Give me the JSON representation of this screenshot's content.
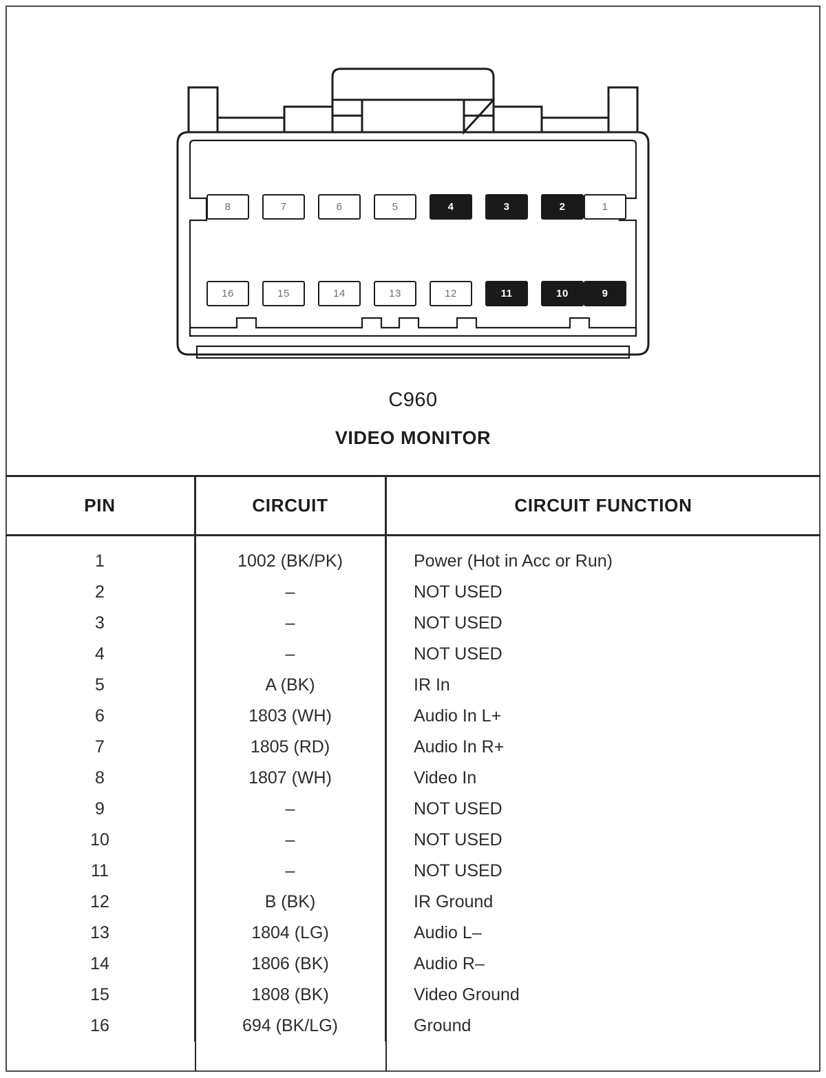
{
  "figure": {
    "connector_id": "C960",
    "connector_name": "VIDEO MONITOR",
    "pin_rows": {
      "top": [
        {
          "number": "8",
          "filled": false
        },
        {
          "number": "7",
          "filled": false
        },
        {
          "number": "6",
          "filled": false
        },
        {
          "number": "5",
          "filled": false
        },
        {
          "number": "4",
          "filled": true
        },
        {
          "number": "3",
          "filled": true
        },
        {
          "number": "2",
          "filled": true
        },
        {
          "number": "1",
          "filled": false
        }
      ],
      "bottom": [
        {
          "number": "16",
          "filled": false
        },
        {
          "number": "15",
          "filled": false
        },
        {
          "number": "14",
          "filled": false
        },
        {
          "number": "13",
          "filled": false
        },
        {
          "number": "12",
          "filled": false
        },
        {
          "number": "11",
          "filled": true
        },
        {
          "number": "10",
          "filled": true
        },
        {
          "number": "9",
          "filled": true
        }
      ]
    }
  },
  "table": {
    "headers": {
      "pin": "PIN",
      "circuit": "CIRCUIT",
      "function": "CIRCUIT FUNCTION"
    },
    "rows": [
      {
        "pin": "1",
        "circuit": "1002 (BK/PK)",
        "function": "Power (Hot in Acc or Run)"
      },
      {
        "pin": "2",
        "circuit": "–",
        "function": "NOT USED"
      },
      {
        "pin": "3",
        "circuit": "–",
        "function": "NOT USED"
      },
      {
        "pin": "4",
        "circuit": "–",
        "function": "NOT USED"
      },
      {
        "pin": "5",
        "circuit": "A (BK)",
        "function": "IR In"
      },
      {
        "pin": "6",
        "circuit": "1803 (WH)",
        "function": "Audio In L+"
      },
      {
        "pin": "7",
        "circuit": "1805 (RD)",
        "function": "Audio In R+"
      },
      {
        "pin": "8",
        "circuit": "1807 (WH)",
        "function": "Video In"
      },
      {
        "pin": "9",
        "circuit": "–",
        "function": "NOT USED"
      },
      {
        "pin": "10",
        "circuit": "–",
        "function": "NOT USED"
      },
      {
        "pin": "11",
        "circuit": "–",
        "function": "NOT USED"
      },
      {
        "pin": "12",
        "circuit": "B (BK)",
        "function": "IR Ground"
      },
      {
        "pin": "13",
        "circuit": "1804 (LG)",
        "function": "Audio L–"
      },
      {
        "pin": "14",
        "circuit": "1806 (BK)",
        "function": "Audio R–"
      },
      {
        "pin": "15",
        "circuit": "1808 (BK)",
        "function": "Video Ground"
      },
      {
        "pin": "16",
        "circuit": "694 (BK/LG)",
        "function": "Ground"
      }
    ]
  },
  "colors": {
    "ink": "#1d1d1d",
    "rule": "#2a2a2a",
    "filled_pin": "#1a1a1a",
    "page": "#ffffff"
  }
}
